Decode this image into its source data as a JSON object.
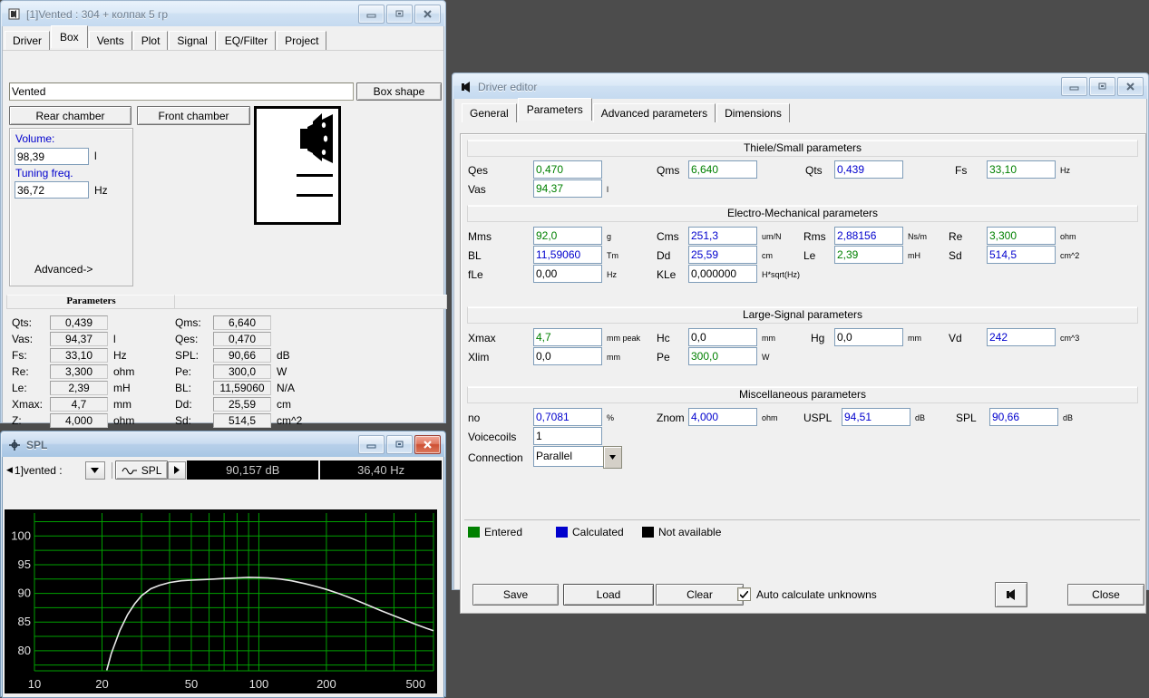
{
  "desktop": {
    "bg": "#4c4c4c"
  },
  "main_window": {
    "title": "[1]Vented : 304 + колпак 5 гр",
    "icon": "speaker-icon",
    "tabs": [
      {
        "label": "Driver",
        "selected": false
      },
      {
        "label": "Box",
        "selected": true
      },
      {
        "label": "Vents",
        "selected": false
      },
      {
        "label": "Plot",
        "selected": false
      },
      {
        "label": "Signal",
        "selected": false
      },
      {
        "label": "EQ/Filter",
        "selected": false
      },
      {
        "label": "Project",
        "selected": false
      }
    ],
    "box_name": "Vented",
    "box_shape_button": "Box shape",
    "rear_chamber_button": "Rear chamber",
    "front_chamber_button": "Front chamber",
    "chamber": {
      "volume_label": "Volume:",
      "volume_value": "98,39",
      "volume_unit": "l",
      "tuning_label": "Tuning freq.",
      "tuning_value": "36,72",
      "tuning_unit": "Hz",
      "advanced_label": "Advanced->"
    },
    "parameters": {
      "header": "Parameters",
      "left": [
        {
          "name": "Qts:",
          "value": "0,439",
          "unit": ""
        },
        {
          "name": "Vas:",
          "value": "94,37",
          "unit": "l"
        },
        {
          "name": "Fs:",
          "value": "33,10",
          "unit": "Hz"
        },
        {
          "name": "Re:",
          "value": "3,300",
          "unit": "ohm"
        },
        {
          "name": "Le:",
          "value": "2,39",
          "unit": "mH"
        },
        {
          "name": "Xmax:",
          "value": "4,7",
          "unit": "mm"
        },
        {
          "name": "Z:",
          "value": "4,000",
          "unit": "ohm"
        }
      ],
      "right": [
        {
          "name": "Qms:",
          "value": "6,640",
          "unit": ""
        },
        {
          "name": "Qes:",
          "value": "0,470",
          "unit": ""
        },
        {
          "name": "SPL:",
          "value": "90,66",
          "unit": "dB"
        },
        {
          "name": "Pe:",
          "value": "300,0",
          "unit": "W"
        },
        {
          "name": "BL:",
          "value": "11,59060",
          "unit": "N/A"
        },
        {
          "name": "Dd:",
          "value": "25,59",
          "unit": "cm"
        },
        {
          "name": "Sd:",
          "value": "514,5",
          "unit": "cm^2"
        }
      ]
    }
  },
  "spl_window": {
    "title": "SPL",
    "icon": "crosshair-icon",
    "curve_selector": "1]vented :",
    "plot_type": "SPL",
    "readout_db": "90,157 dB",
    "readout_hz": "36,40 Hz"
  },
  "chart_data": {
    "type": "line",
    "title": "SPL",
    "xlabel": "",
    "ylabel": "",
    "xscale": "log",
    "xlim": [
      10,
      600
    ],
    "ylim": [
      76.5,
      104
    ],
    "xticks": [
      10,
      20,
      50,
      100,
      200,
      500
    ],
    "xtick_labels": [
      "10",
      "20",
      "50",
      "100",
      "200",
      "500"
    ],
    "yticks": [
      80,
      85,
      90,
      95,
      100
    ],
    "ytick_labels": [
      "80",
      "85",
      "90",
      "95",
      "100"
    ],
    "grid": true,
    "grid_color": "#00a000",
    "bg_color": "#000000",
    "line_color": "#e8e8e8",
    "series": [
      {
        "name": "SPL",
        "x": [
          21,
          22,
          24,
          26,
          28,
          30,
          33,
          36,
          40,
          45,
          50,
          56,
          63,
          70,
          80,
          90,
          100,
          110,
          125,
          140,
          160,
          180,
          200,
          230,
          260,
          300,
          350,
          400,
          450,
          500,
          560,
          600
        ],
        "y": [
          76.6,
          79.5,
          83.5,
          86.3,
          88.2,
          89.6,
          90.8,
          91.4,
          91.9,
          92.2,
          92.3,
          92.4,
          92.5,
          92.6,
          92.7,
          92.8,
          92.75,
          92.7,
          92.5,
          92.2,
          91.7,
          91.2,
          90.7,
          89.9,
          89.1,
          88.1,
          87.0,
          86.1,
          85.3,
          84.6,
          83.9,
          83.5
        ]
      }
    ]
  },
  "driver_editor": {
    "title": "Driver editor",
    "icon": "driver-icon",
    "tabs": [
      {
        "label": "General",
        "selected": false
      },
      {
        "label": "Parameters",
        "selected": true
      },
      {
        "label": "Advanced parameters",
        "selected": false
      },
      {
        "label": "Dimensions",
        "selected": false
      }
    ],
    "sections": {
      "thiele_small": {
        "header": "Thiele/Small parameters",
        "fields": [
          {
            "label": "Qes",
            "value": "0,470",
            "unit": "",
            "state": "green"
          },
          {
            "label": "Qms",
            "value": "6,640",
            "unit": "",
            "state": "green"
          },
          {
            "label": "Qts",
            "value": "0,439",
            "unit": "",
            "state": "blue"
          },
          {
            "label": "Fs",
            "value": "33,10",
            "unit": "Hz",
            "state": "green"
          },
          {
            "label": "Vas",
            "value": "94,37",
            "unit": "l",
            "state": "green"
          }
        ]
      },
      "electro_mechanical": {
        "header": "Electro-Mechanical parameters",
        "fields": [
          {
            "label": "Mms",
            "value": "92,0",
            "unit": "g",
            "state": "green"
          },
          {
            "label": "Cms",
            "value": "251,3",
            "unit": "um/N",
            "state": "blue"
          },
          {
            "label": "Rms",
            "value": "2,88156",
            "unit": "Ns/m",
            "state": "blue"
          },
          {
            "label": "Re",
            "value": "3,300",
            "unit": "ohm",
            "state": "green"
          },
          {
            "label": "BL",
            "value": "11,59060",
            "unit": "Tm",
            "state": "blue"
          },
          {
            "label": "Dd",
            "value": "25,59",
            "unit": "cm",
            "state": "blue"
          },
          {
            "label": "Le",
            "value": "2,39",
            "unit": "mH",
            "state": "green"
          },
          {
            "label": "Sd",
            "value": "514,5",
            "unit": "cm^2",
            "state": "blue"
          },
          {
            "label": "fLe",
            "value": "0,00",
            "unit": "Hz",
            "state": "black"
          },
          {
            "label": "KLe",
            "value": "0,000000",
            "unit": "H*sqrt(Hz)",
            "state": "black"
          }
        ]
      },
      "large_signal": {
        "header": "Large-Signal parameters",
        "fields": [
          {
            "label": "Xmax",
            "value": "4,7",
            "unit": "mm peak",
            "state": "green"
          },
          {
            "label": "Hc",
            "value": "0,0",
            "unit": "mm",
            "state": "black"
          },
          {
            "label": "Hg",
            "value": "0,0",
            "unit": "mm",
            "state": "black"
          },
          {
            "label": "Vd",
            "value": "242",
            "unit": "cm^3",
            "state": "blue"
          },
          {
            "label": "Xlim",
            "value": "0,0",
            "unit": "mm",
            "state": "black"
          },
          {
            "label": "Pe",
            "value": "300,0",
            "unit": "W",
            "state": "green"
          }
        ]
      },
      "misc": {
        "header": "Miscellaneous parameters",
        "fields": [
          {
            "label": "no",
            "value": "0,7081",
            "unit": "%",
            "state": "blue"
          },
          {
            "label": "Znom",
            "value": "4,000",
            "unit": "ohm",
            "state": "blue"
          },
          {
            "label": "USPL",
            "value": "94,51",
            "unit": "dB",
            "state": "blue"
          },
          {
            "label": "SPL",
            "value": "90,66",
            "unit": "dB",
            "state": "blue"
          }
        ],
        "voicecoils_label": "Voicecoils",
        "voicecoils_value": "1",
        "connection_label": "Connection",
        "connection_value": "Parallel"
      }
    },
    "legend": [
      {
        "label": "Entered",
        "color": "#008000"
      },
      {
        "label": "Calculated",
        "color": "#0000cd"
      },
      {
        "label": "Not available",
        "color": "#000000"
      }
    ],
    "buttons": {
      "save": "Save",
      "load": "Load",
      "clear": "Clear",
      "close": "Close",
      "auto_calc_label": "Auto calculate unknowns",
      "auto_calc_checked": true
    }
  }
}
